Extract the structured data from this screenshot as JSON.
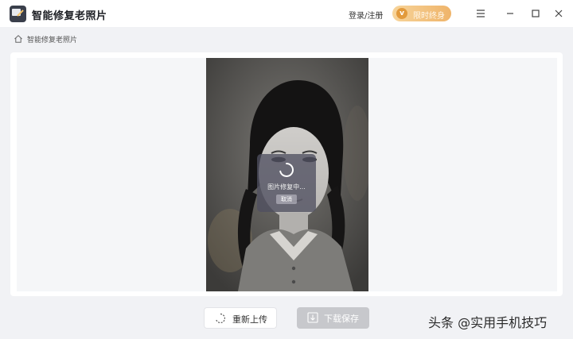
{
  "app": {
    "title": "智能修复老照片",
    "logo_icon": "photo-repair-logo-icon"
  },
  "header": {
    "login_label": "登录/注册",
    "vip_label": "限时终身",
    "vip_icon": "v",
    "vip_colors": [
      "#f7d49a",
      "#efb46a"
    ],
    "window_controls": [
      "menu-icon",
      "minimize-icon",
      "maximize-icon",
      "close-icon"
    ]
  },
  "breadcrumb": {
    "icon": "home-icon",
    "label": "智能修复老照片"
  },
  "overlay": {
    "status_text": "图片修复中...",
    "cancel_label": "取消"
  },
  "actions": {
    "reupload_label": "重新上传",
    "download_label": "下载保存"
  },
  "watermark": "头条 @实用手机技巧"
}
